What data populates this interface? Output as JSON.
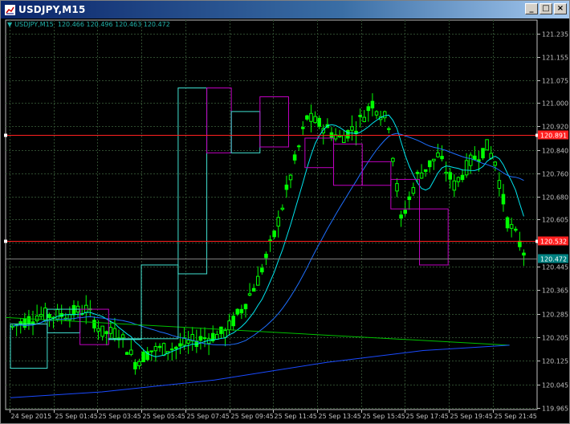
{
  "window": {
    "title": "USDJPY,M15",
    "buttons": [
      "_",
      "□",
      "×"
    ]
  },
  "chart_info": {
    "symbol_tf": "USDJPY,M15",
    "ohlc": "120.466 120.496 120.463 120.472"
  },
  "price_axis": {
    "ticks": [
      "121.235",
      "121.155",
      "121.075",
      "121.000",
      "120.920",
      "120.840",
      "120.760",
      "120.680",
      "120.605",
      "120.525",
      "120.445",
      "120.365",
      "120.285",
      "120.205",
      "120.125",
      "120.045",
      "119.965"
    ],
    "ymin": 119.96,
    "ymax": 121.28
  },
  "time_axis": {
    "labels": [
      "24 Sep 2015",
      "25 Sep 01:45",
      "25 Sep 03:45",
      "25 Sep 05:45",
      "25 Sep 07:45",
      "25 Sep 09:45",
      "25 Sep 11:45",
      "25 Sep 13:45",
      "25 Sep 15:45",
      "25 Sep 17:45",
      "25 Sep 19:45",
      "25 Sep 21:45"
    ]
  },
  "hlines": [
    {
      "price": 120.891,
      "label": "120.891",
      "color": "#ff2020"
    },
    {
      "price": 120.532,
      "label": "120.532",
      "color": "#ff2020"
    }
  ],
  "current_price": {
    "price": 120.472,
    "label": "120.472",
    "color": "#008080"
  },
  "colors": {
    "grid": "#2e4a2e",
    "bull": "#00ff00",
    "bear": "#00ff00",
    "ma_fast": "#00e5ee",
    "ma_slow": "#1e6fff",
    "ma_green": "#00c000",
    "box_up": "#40e0d0",
    "box_down": "#c000c0",
    "axis_text": "#c0c0c0"
  },
  "chart_data": {
    "type": "candlestick",
    "series": [
      {
        "name": "USDJPY,M15"
      }
    ]
  }
}
